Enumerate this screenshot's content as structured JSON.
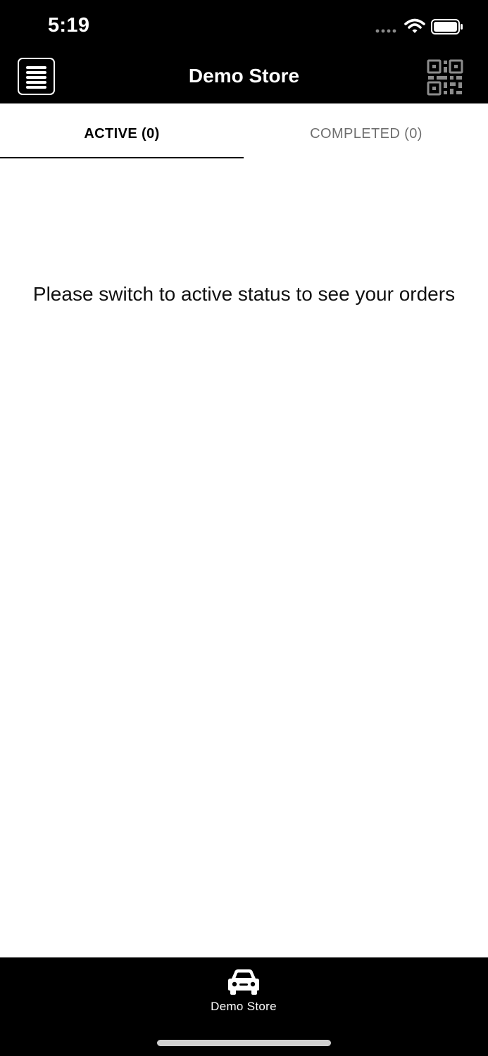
{
  "status_bar": {
    "time": "5:19",
    "icons": [
      "signal-icon",
      "wifi-icon",
      "battery-icon"
    ]
  },
  "header": {
    "title": "Demo Store",
    "left_icon": "menu-icon",
    "right_icon": "qr-code-icon"
  },
  "tabs": [
    {
      "label": "ACTIVE (0)",
      "selected": true
    },
    {
      "label": "COMPLETED (0)",
      "selected": false
    }
  ],
  "main": {
    "empty_message": "Please switch to active status to see your orders"
  },
  "bottom_nav": {
    "items": [
      {
        "label": "Demo Store",
        "icon": "car-icon"
      }
    ]
  },
  "colors": {
    "bar_background": "#000000",
    "page_background": "#ffffff",
    "inactive_tab_text": "#6f6f6f"
  }
}
